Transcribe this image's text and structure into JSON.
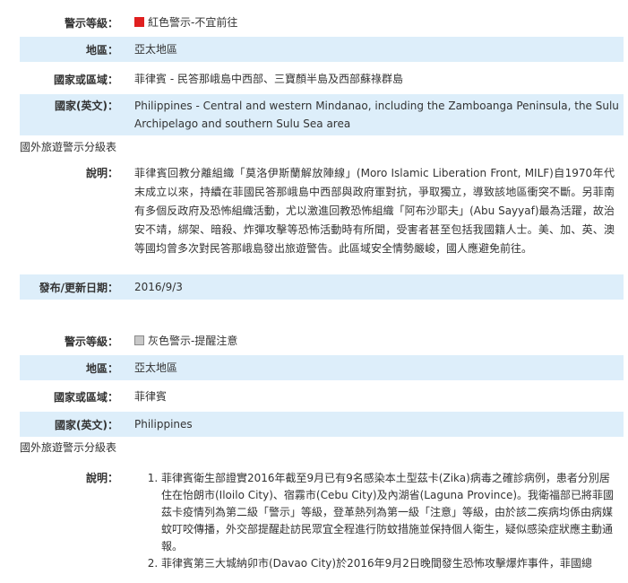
{
  "labels": {
    "level": "警示等級：",
    "region": "地區：",
    "country": "國家或區域：",
    "country_en": "國家(英文)：",
    "description": "說明：",
    "published": "發布/更新日期：",
    "note": "國外旅遊警示分級表"
  },
  "entry1": {
    "level": "紅色警示-不宜前往",
    "level_color": "#e02020",
    "region": "亞太地區",
    "country": "菲律賓 - 民答那峨島中西部、三寶顏半島及西部蘇祿群島",
    "country_en": "Philippines - Central and western Mindanao, including the Zamboanga Peninsula, the Sulu Archipelago and southern Sulu Sea area",
    "description": "菲律賓回教分離組織「莫洛伊斯蘭解放陣線」(Moro Islamic Liberation Front, MILF)自1970年代末成立以來，持續在菲國民答那峨島中西部與政府軍對抗，爭取獨立，導致該地區衝突不斷。另菲南有多個反政府及恐怖組織活動，尤以激進回教恐怖組織「阿布沙耶夫」(Abu Sayyaf)最為活躍，故治安不靖，綁架、暗殺、炸彈攻擊等恐怖活動時有所聞，受害者甚至包括我國籍人士。美、加、英、澳等國均曾多次對民答那峨島發出旅遊警告。此區域安全情勢嚴峻，國人應避免前往。",
    "published": "2016/9/3"
  },
  "entry2": {
    "level": "灰色警示-提醒注意",
    "level_color": "#c8c8c8",
    "region": "亞太地區",
    "country": "菲律賓",
    "country_en": "Philippines",
    "description_items": [
      "菲律賓衛生部證實2016年截至9月已有9名感染本土型茲卡(Zika)病毒之確診病例，患者分別居住在怡朗市(Iloilo City)、宿霧市(Cebu City)及內湖省(Laguna Province)。我衛福部已將菲國茲卡疫情列為第二級「警示」等級，登革熱列為第一級「注意」等級，由於該二疾病均係由病媒蚊叮咬傳播，外交部提醒赴訪民眾宜全程進行防蚊措施並保持個人衛生，疑似感染症狀應主動通報。",
      "菲律賓第三大城納卯市(Davao City)於2016年9月2日晚間發生恐怖攻擊爆炸事件，菲國總"
    ]
  }
}
